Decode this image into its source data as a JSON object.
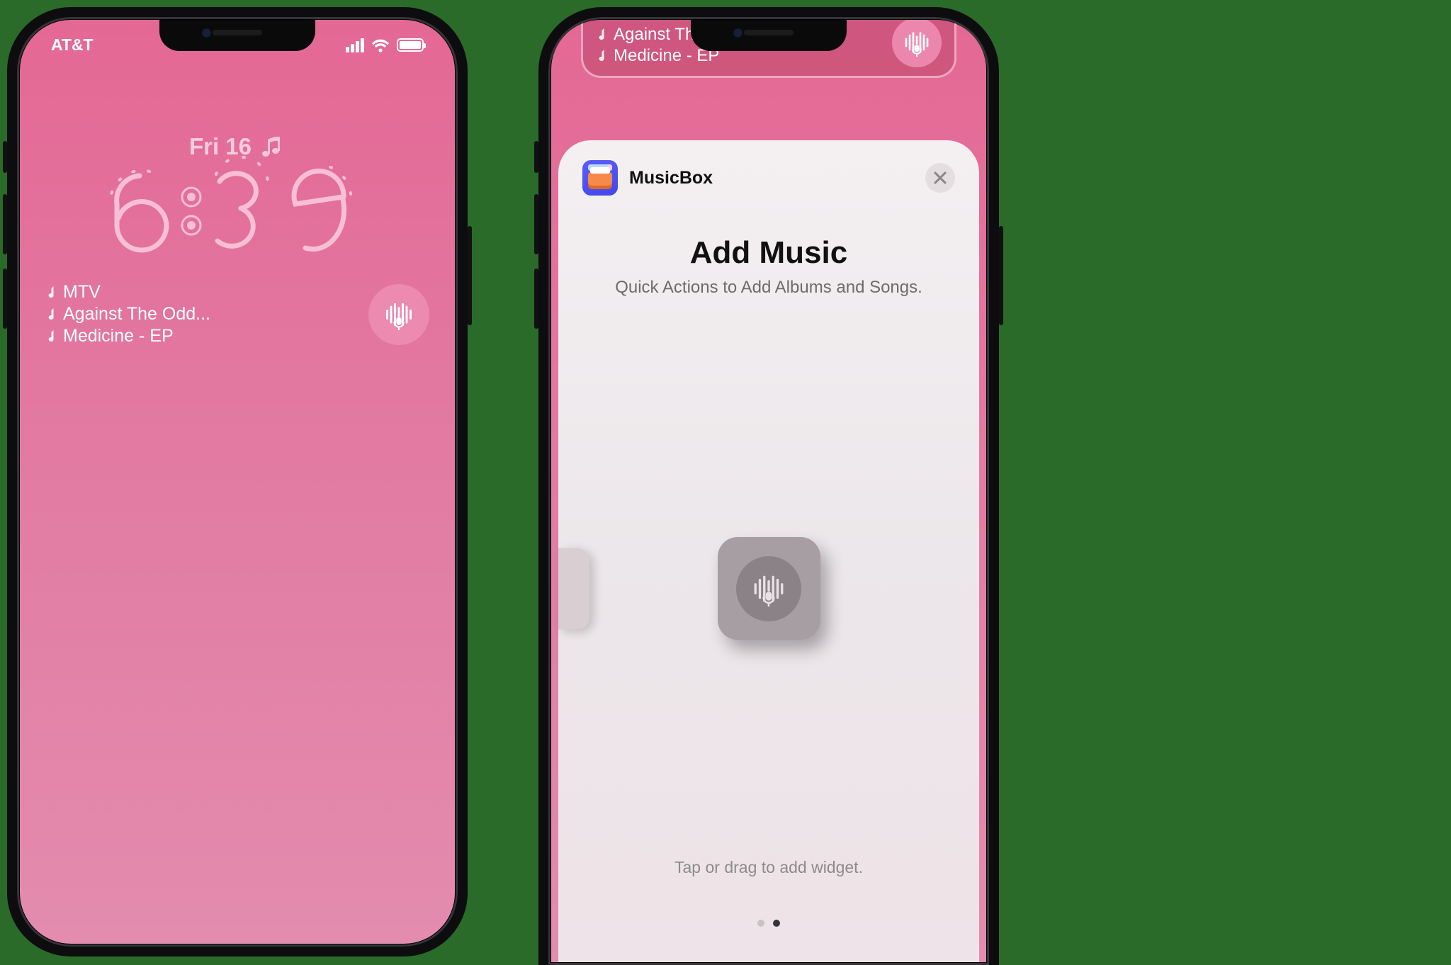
{
  "left": {
    "carrier": "AT&T",
    "date": "Fri 16",
    "time": "6:39",
    "songs": [
      "MTV",
      "Against The Odd...",
      "Medicine - EP"
    ]
  },
  "right": {
    "songs": [
      "Against The Odd...",
      "Medicine - EP"
    ],
    "app_name": "MusicBox",
    "sheet_title": "Add Music",
    "sheet_subtitle": "Quick Actions to Add Albums and Songs.",
    "hint": "Tap or drag to add widget."
  }
}
